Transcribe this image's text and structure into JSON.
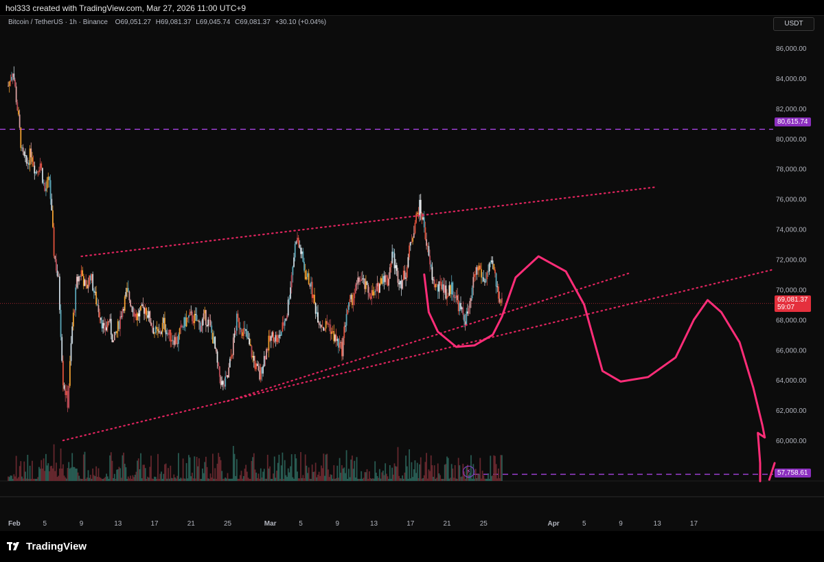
{
  "header": {
    "credit": "hol333 created with TradingView.com, Mar 27, 2026 11:00 UTC+9"
  },
  "legend": {
    "symbol": "Bitcoin / TetherUS · 1h · Binance",
    "open": "O69,051.27",
    "high": "H69,081.37",
    "low": "L69,045.74",
    "close": "C69,081.37",
    "change": "+30.10 (+0.04%)"
  },
  "currency": "USDT",
  "levels": {
    "upper": "80,615.74",
    "lower": "57,758.61",
    "current": "69,081.37",
    "countdown": "59:07"
  },
  "brand": "TradingView",
  "colors": {
    "background": "#0c0c0c",
    "level_line": "#9b3fd0",
    "trendline": "#e0245e",
    "projection": "#ff2d78",
    "current_price": "#e5303d"
  },
  "chart_data": {
    "type": "candlestick",
    "title": "Bitcoin / TetherUS · 1h · Binance",
    "y_unit": "USDT",
    "ylim": [
      57000,
      87500
    ],
    "y_ticks": [
      86000,
      84000,
      82000,
      80000,
      78000,
      76000,
      74000,
      72000,
      70000,
      68000,
      66000,
      64000,
      62000,
      60000
    ],
    "y_tick_labels": [
      "86,000.00",
      "84,000.00",
      "82,000.00",
      "80,000.00",
      "78,000.00",
      "76,000.00",
      "74,000.00",
      "72,000.00",
      "70,000.00",
      "68,000.00",
      "66,000.00",
      "64,000.00",
      "62,000.00",
      "60,000.00"
    ],
    "xlim": [
      "2026-02-01",
      "2026-04-25"
    ],
    "x_ticks": [
      "2026-02-01",
      "2026-02-05",
      "2026-02-09",
      "2026-02-13",
      "2026-02-17",
      "2026-02-21",
      "2026-02-25",
      "2026-03-01",
      "2026-03-05",
      "2026-03-09",
      "2026-03-13",
      "2026-03-17",
      "2026-03-21",
      "2026-03-25",
      "2026-04-01",
      "2026-04-05",
      "2026-04-09",
      "2026-04-13",
      "2026-04-17"
    ],
    "x_tick_labels": [
      "Feb",
      "5",
      "9",
      "13",
      "17",
      "21",
      "25",
      "Mar",
      "5",
      "9",
      "13",
      "17",
      "21",
      "25",
      "Apr",
      "5",
      "9",
      "13",
      "17"
    ],
    "price_path": [
      [
        "2026-02-01",
        83500
      ],
      [
        "2026-02-01T12",
        84600
      ],
      [
        "2026-02-02",
        82000
      ],
      [
        "2026-02-02T12",
        79000
      ],
      [
        "2026-02-03",
        78300
      ],
      [
        "2026-02-03T12",
        79100
      ],
      [
        "2026-02-04",
        77800
      ],
      [
        "2026-02-04T12",
        78400
      ],
      [
        "2026-02-05",
        76500
      ],
      [
        "2026-02-05T12",
        77300
      ],
      [
        "2026-02-06",
        72500
      ],
      [
        "2026-02-06T12",
        70500
      ],
      [
        "2026-02-07",
        64000
      ],
      [
        "2026-02-07T12",
        62500
      ],
      [
        "2026-02-08",
        67500
      ],
      [
        "2026-02-08T12",
        70500
      ],
      [
        "2026-02-09",
        71200
      ],
      [
        "2026-02-09T12",
        70000
      ],
      [
        "2026-02-10",
        71000
      ],
      [
        "2026-02-10T12",
        69500
      ],
      [
        "2026-02-11",
        68500
      ],
      [
        "2026-02-11T12",
        67200
      ],
      [
        "2026-02-12",
        68000
      ],
      [
        "2026-02-12T12",
        66500
      ],
      [
        "2026-02-13",
        67500
      ],
      [
        "2026-02-13T12",
        68800
      ],
      [
        "2026-02-14",
        69800
      ],
      [
        "2026-02-14T12",
        69000
      ],
      [
        "2026-02-15",
        68200
      ],
      [
        "2026-02-15T12",
        68500
      ],
      [
        "2026-02-16",
        68800
      ],
      [
        "2026-02-16T12",
        68000
      ],
      [
        "2026-02-17",
        67200
      ],
      [
        "2026-02-17T12",
        67000
      ],
      [
        "2026-02-18",
        67800
      ],
      [
        "2026-02-18T12",
        67000
      ],
      [
        "2026-02-19",
        66800
      ],
      [
        "2026-02-19T12",
        66600
      ],
      [
        "2026-02-20",
        67500
      ],
      [
        "2026-02-20T12",
        68000
      ],
      [
        "2026-02-21",
        68200
      ],
      [
        "2026-02-21T12",
        68000
      ],
      [
        "2026-02-22",
        67600
      ],
      [
        "2026-02-22T12",
        68200
      ],
      [
        "2026-02-23",
        67700
      ],
      [
        "2026-02-23T12",
        66500
      ],
      [
        "2026-02-24",
        64500
      ],
      [
        "2026-02-24T12",
        63500
      ],
      [
        "2026-02-25",
        64200
      ],
      [
        "2026-02-25T12",
        66000
      ],
      [
        "2026-02-26",
        68000
      ],
      [
        "2026-02-26T12",
        67500
      ],
      [
        "2026-02-27",
        67000
      ],
      [
        "2026-02-27T12",
        66000
      ],
      [
        "2026-02-28",
        65000
      ],
      [
        "2026-02-28T12",
        64200
      ],
      [
        "2026-03-01",
        65500
      ],
      [
        "2026-03-01T12",
        66500
      ],
      [
        "2026-03-02",
        67000
      ],
      [
        "2026-03-02T12",
        66600
      ],
      [
        "2026-03-03",
        67500
      ],
      [
        "2026-03-03T12",
        68500
      ],
      [
        "2026-03-04",
        71000
      ],
      [
        "2026-03-04T12",
        73500
      ],
      [
        "2026-03-05",
        72500
      ],
      [
        "2026-03-05T12",
        71000
      ],
      [
        "2026-03-06",
        70500
      ],
      [
        "2026-03-06T12",
        69000
      ],
      [
        "2026-03-07",
        68000
      ],
      [
        "2026-03-07T12",
        67500
      ],
      [
        "2026-03-08",
        67800
      ],
      [
        "2026-03-08T12",
        67000
      ],
      [
        "2026-03-09",
        66500
      ],
      [
        "2026-03-09T12",
        66000
      ],
      [
        "2026-03-10",
        68500
      ],
      [
        "2026-03-10T12",
        69200
      ],
      [
        "2026-03-11",
        70000
      ],
      [
        "2026-03-11T12",
        70800
      ],
      [
        "2026-03-12",
        70200
      ],
      [
        "2026-03-12T12",
        69800
      ],
      [
        "2026-03-13",
        69600
      ],
      [
        "2026-03-13T12",
        70200
      ],
      [
        "2026-03-14",
        71000
      ],
      [
        "2026-03-14T12",
        70500
      ],
      [
        "2026-03-15",
        72500
      ],
      [
        "2026-03-15T12",
        71000
      ],
      [
        "2026-03-16",
        70500
      ],
      [
        "2026-03-16T12",
        71200
      ],
      [
        "2026-03-17",
        73000
      ],
      [
        "2026-03-17T12",
        74500
      ],
      [
        "2026-03-18",
        75500
      ],
      [
        "2026-03-18T12",
        74200
      ],
      [
        "2026-03-19",
        72000
      ],
      [
        "2026-03-19T12",
        70500
      ],
      [
        "2026-03-20",
        70000
      ],
      [
        "2026-03-20T12",
        70400
      ],
      [
        "2026-03-21",
        69600
      ],
      [
        "2026-03-21T12",
        70200
      ],
      [
        "2026-03-22",
        69400
      ],
      [
        "2026-03-22T12",
        68600
      ],
      [
        "2026-03-23",
        68000
      ],
      [
        "2026-03-23T12",
        68800
      ],
      [
        "2026-03-24",
        71000
      ],
      [
        "2026-03-24T12",
        71500
      ],
      [
        "2026-03-25",
        70500
      ],
      [
        "2026-03-25T12",
        71200
      ],
      [
        "2026-03-26",
        71600
      ],
      [
        "2026-03-26T12",
        70000
      ],
      [
        "2026-03-27",
        69081
      ]
    ]
  }
}
